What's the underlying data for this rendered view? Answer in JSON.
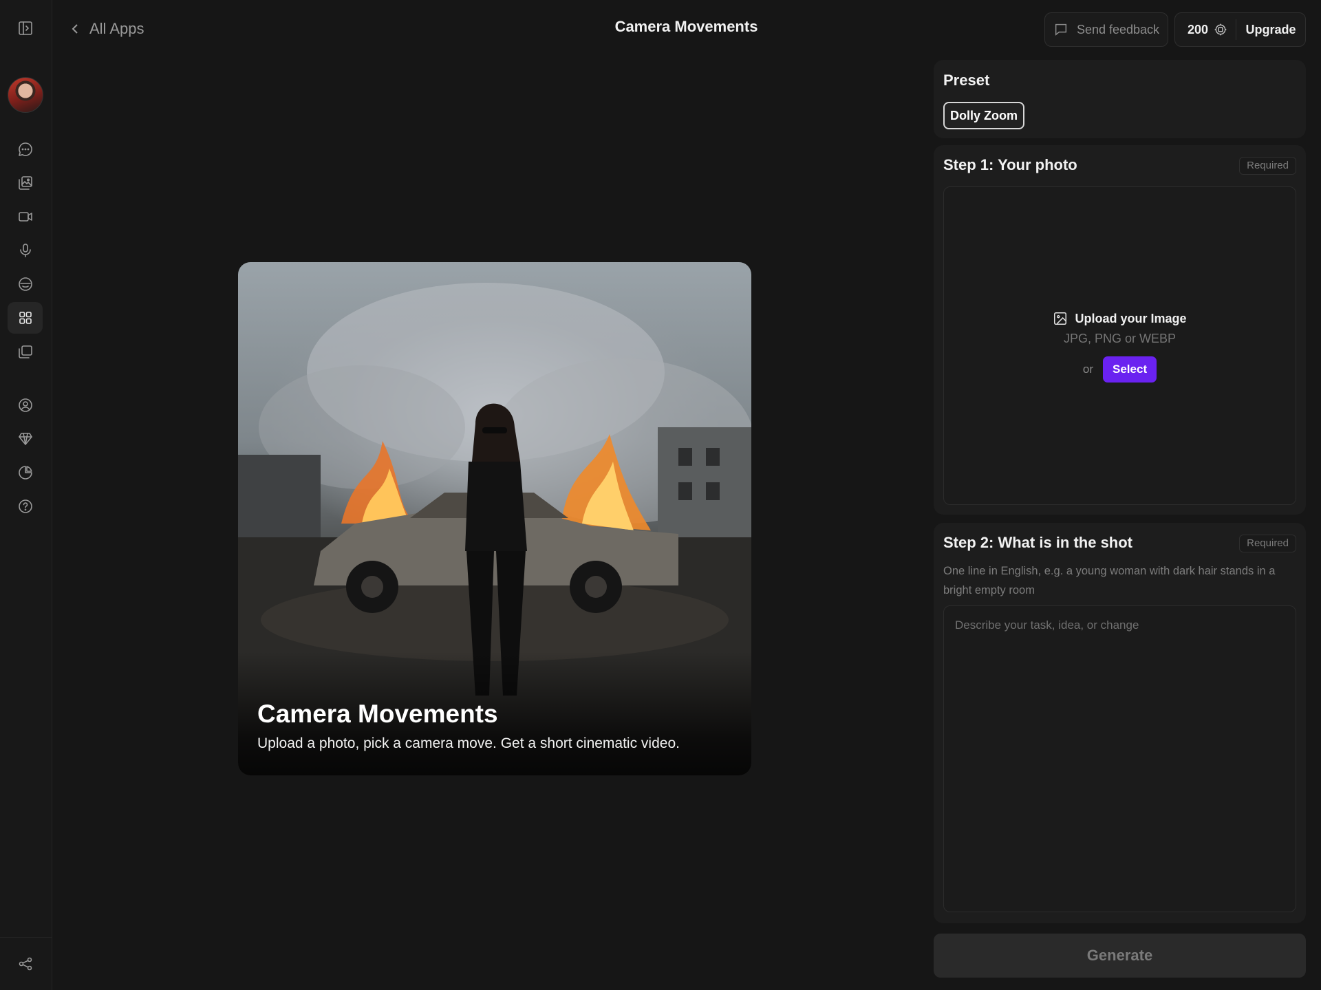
{
  "header": {
    "back_label": "All Apps",
    "title": "Camera Movements",
    "feedback_label": "Send feedback",
    "credits": "200",
    "upgrade_label": "Upgrade"
  },
  "sidebar": {
    "items": [
      {
        "icon": "chat-icon"
      },
      {
        "icon": "image-gallery-icon"
      },
      {
        "icon": "video-icon"
      },
      {
        "icon": "microphone-icon"
      },
      {
        "icon": "smiley-icon"
      },
      {
        "icon": "apps-grid-icon",
        "active": true
      },
      {
        "icon": "folders-icon"
      },
      {
        "icon": "user-circle-icon"
      },
      {
        "icon": "diamond-icon"
      },
      {
        "icon": "pie-chart-icon"
      },
      {
        "icon": "help-icon"
      },
      {
        "icon": "share-icon"
      }
    ]
  },
  "hero": {
    "title": "Camera Movements",
    "subtitle": "Upload a photo, pick a camera move. Get a short cinematic video."
  },
  "preset": {
    "heading": "Preset",
    "selected": "Dolly Zoom"
  },
  "step1": {
    "heading": "Step 1: Your photo",
    "required": "Required",
    "upload_label": "Upload your Image",
    "formats": "JPG, PNG or WEBP",
    "or": "or",
    "select_label": "Select"
  },
  "step2": {
    "heading": "Step 2: What is in the shot",
    "required": "Required",
    "hint": "One line in English, e.g. a young woman with dark hair stands in a bright empty room",
    "placeholder": "Describe your task, idea, or change"
  },
  "generate_label": "Generate",
  "colors": {
    "background": "#161616",
    "panel": "#1d1d1d",
    "accent": "#6a22f0"
  }
}
